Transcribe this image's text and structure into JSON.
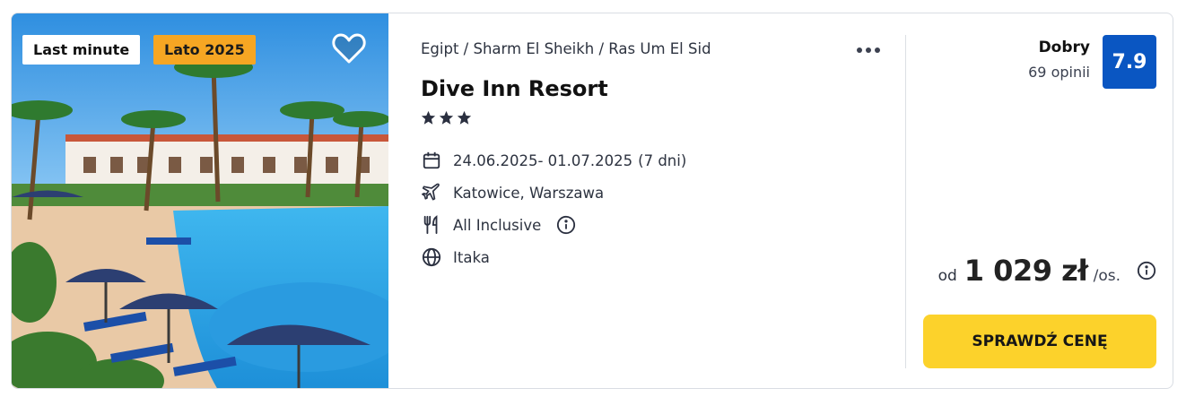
{
  "badges": {
    "last_minute": "Last minute",
    "season": "Lato 2025"
  },
  "breadcrumb": "Egipt / Sharm El Sheikh / Ras Um El Sid",
  "hotel": {
    "name": "Dive Inn Resort",
    "stars": 3
  },
  "details": {
    "dates": "24.06.2025- 01.07.2025",
    "nights": "(7 dni)",
    "departure": "Katowice, Warszawa",
    "board": "All Inclusive",
    "operator": "Itaka"
  },
  "rating": {
    "label": "Dobry",
    "count": "69 opinii",
    "score": "7.9"
  },
  "price": {
    "from": "od",
    "value": "1 029 zł",
    "unit": "/os."
  },
  "cta_label": "SPRAWDŹ CENĘ",
  "colors": {
    "season_badge": "#f6a623",
    "rating_box": "#0a56c2",
    "cta": "#fcd22b"
  },
  "icons": [
    "heart-icon",
    "more-icon",
    "star-icon",
    "calendar-icon",
    "plane-icon",
    "cutlery-icon",
    "info-icon",
    "globe-icon"
  ]
}
